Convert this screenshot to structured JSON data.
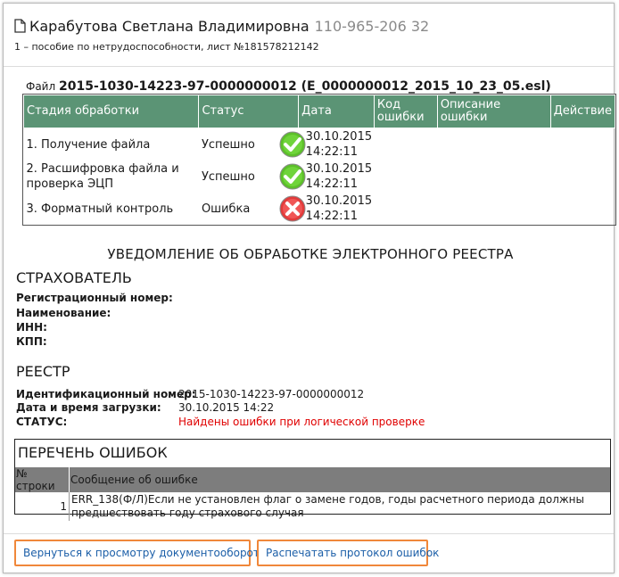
{
  "header": {
    "person_name": "Карабутова Светлана Владимировна",
    "snils": "110-965-206 32",
    "subtitle": "1 – пособие по нетрудоспособности, лист №181578212142"
  },
  "file": {
    "label": "Файл",
    "name": "2015-1030-14223-97-0000000012 (E_0000000012_2015_10_23_05.esl)"
  },
  "stages_table": {
    "columns": [
      "Стадия обработки",
      "Статус",
      "Дата",
      "Код ошибки",
      "Описание ошибки",
      "Действие"
    ],
    "rows": [
      {
        "stage": "1. Получение файла",
        "status": "Успешно",
        "icon": "check-icon",
        "date": "30.10.2015",
        "time": "14:22:11",
        "code": "",
        "description": "",
        "action": ""
      },
      {
        "stage": "2. Расшифровка файла и проверка ЭЦП",
        "status": "Успешно",
        "icon": "check-icon",
        "date": "30.10.2015",
        "time": "14:22:11",
        "code": "",
        "description": "",
        "action": ""
      },
      {
        "stage": "3. Форматный контроль",
        "status": "Ошибка",
        "icon": "error-icon",
        "date": "30.10.2015",
        "time": "14:22:11",
        "code": "",
        "description": "",
        "action": ""
      }
    ]
  },
  "notice": {
    "title": "УВЕДОМЛЕНИЕ ОБ ОБРАБОТКЕ ЭЛЕКТРОННОГО РЕЕСТРА",
    "insurer_title": "СТРАХОВАТЕЛЬ",
    "insurer_fields": [
      {
        "label": "Регистрационный номер:",
        "value": ""
      },
      {
        "label": "Наименование:",
        "value": ""
      },
      {
        "label": "ИНН:",
        "value": ""
      },
      {
        "label": "КПП:",
        "value": ""
      }
    ],
    "registry_title": "РЕЕСТР",
    "registry_fields": [
      {
        "label": "Идентификационный номер:",
        "value": "2015-1030-14223-97-0000000012"
      },
      {
        "label": "Дата и время загрузки:",
        "value": "30.10.2015 14:22"
      },
      {
        "label": "СТАТУС:",
        "value": "Найдены ошибки при логической проверке"
      }
    ]
  },
  "errors": {
    "title": "ПЕРЕЧЕНЬ ОШИБОК",
    "columns": [
      "№ строки",
      "Сообщение об ошибке"
    ],
    "rows": [
      {
        "line": "1",
        "message": "ERR_138(Ф/Л)Если не установлен флаг о замене годов, годы расчетного периода должны предшествовать году страхового случая"
      }
    ]
  },
  "actions": {
    "back_label": "Вернуться к просмотру документооборота",
    "print_label": "Распечатать протокол ошибок"
  },
  "colors": {
    "table_header": "#5b9475",
    "errors_header": "#7d7d7d",
    "status_error_text": "#e00000",
    "button_border": "#f0873a",
    "link": "#1c5fa8"
  }
}
